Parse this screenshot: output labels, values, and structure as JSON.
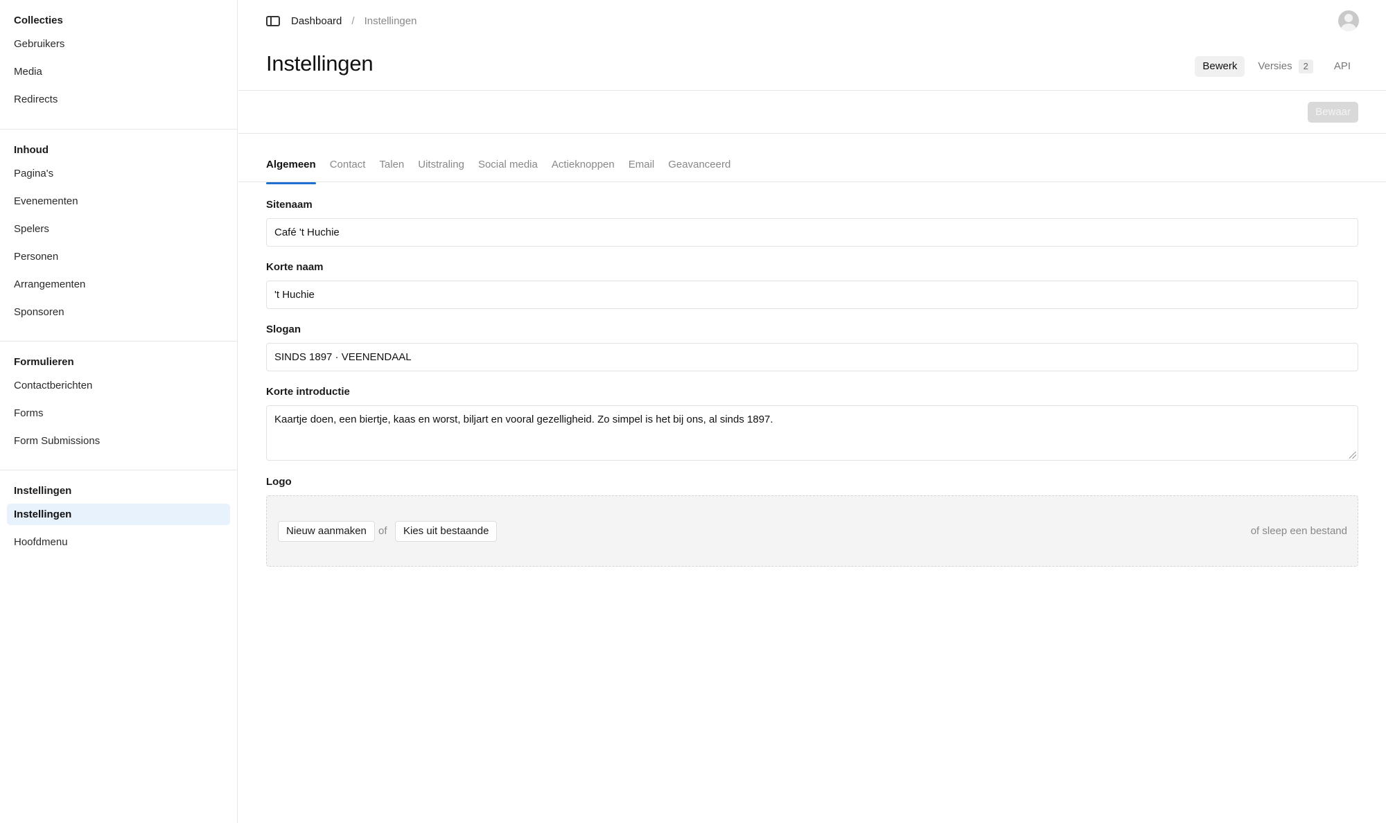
{
  "sidebar": {
    "groups": [
      {
        "title": "Collecties",
        "items": [
          "Gebruikers",
          "Media",
          "Redirects"
        ]
      },
      {
        "title": "Inhoud",
        "items": [
          "Pagina's",
          "Evenementen",
          "Spelers",
          "Personen",
          "Arrangementen",
          "Sponsoren"
        ]
      },
      {
        "title": "Formulieren",
        "items": [
          "Contactberichten",
          "Forms",
          "Form Submissions"
        ]
      },
      {
        "title": "Instellingen",
        "items": [
          "Instellingen",
          "Hoofdmenu"
        ]
      }
    ],
    "active_item": "Instellingen"
  },
  "breadcrumb": {
    "root": "Dashboard",
    "separator": "/",
    "current": "Instellingen"
  },
  "page": {
    "title": "Instellingen"
  },
  "view_tabs": {
    "edit": "Bewerk",
    "versions": "Versies",
    "versions_count": "2",
    "api": "API",
    "active": "Bewerk"
  },
  "toolbar": {
    "save_label": "Bewaar"
  },
  "tabs": {
    "items": [
      "Algemeen",
      "Contact",
      "Talen",
      "Uitstraling",
      "Social media",
      "Actieknoppen",
      "Email",
      "Geavanceerd"
    ],
    "active": "Algemeen"
  },
  "fields": {
    "site_name": {
      "label": "Sitenaam",
      "value": "Café 't Huchie"
    },
    "short_name": {
      "label": "Korte naam",
      "value": "'t Huchie"
    },
    "slogan": {
      "label": "Slogan",
      "value": "SINDS 1897 · VEENENDAAL"
    },
    "intro": {
      "label": "Korte introductie",
      "value": "Kaartje doen, een biertje, kaas en worst, biljart en vooral gezelligheid. Zo simpel is het bij ons, al sinds 1897."
    },
    "logo": {
      "label": "Logo",
      "create_label": "Nieuw aanmaken",
      "or_label": "of",
      "choose_label": "Kies uit bestaande",
      "drop_hint": "of sleep een bestand"
    }
  },
  "colors": {
    "accent": "#1f6fd0",
    "active_nav_bg": "#e8f2fd"
  }
}
